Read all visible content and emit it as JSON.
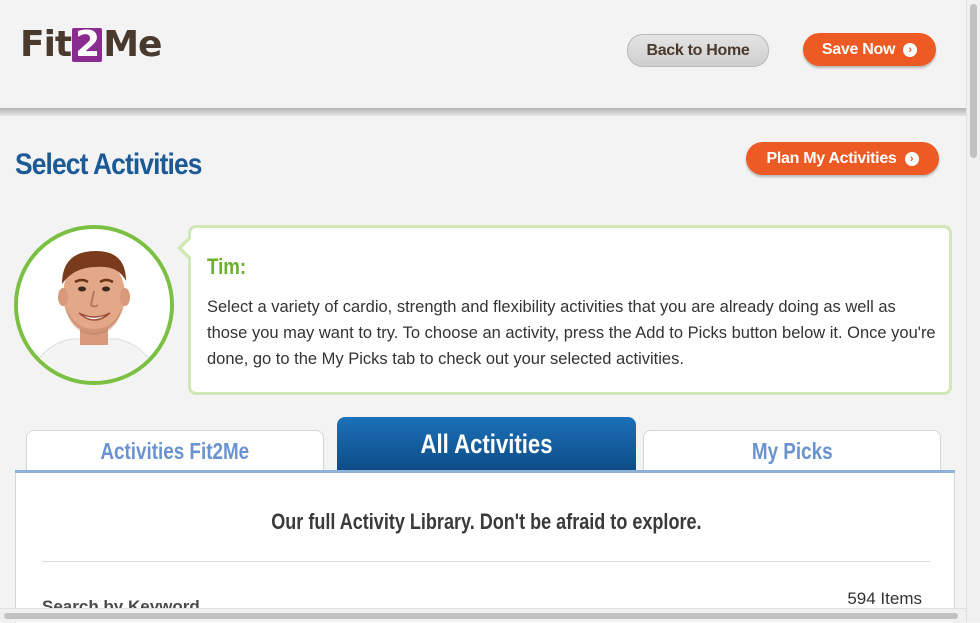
{
  "header": {
    "logo": {
      "part1": "Fit",
      "part2": "2",
      "part3": "Me"
    },
    "back_home_label": "Back to Home",
    "save_now_label": "Save Now"
  },
  "page": {
    "title": "Select Activities",
    "plan_button_label": "Plan My Activities"
  },
  "coach": {
    "name": "Tim:",
    "message": "Select a variety of cardio, strength and flexibility activities that you are already doing as well as those you may want to try. To choose an activity, press the Add to Picks button below it. Once you're done, go to the My Picks tab to check out your selected activities."
  },
  "tabs": [
    {
      "label": "Activities Fit2Me",
      "active": false
    },
    {
      "label": "All Activities",
      "active": true
    },
    {
      "label": "My Picks",
      "active": false
    }
  ],
  "panel": {
    "headline": "Our full Activity Library. Don't be afraid to explore.",
    "search_label": "Search by Keyword",
    "items_count": "594 Items"
  },
  "colors": {
    "accent_orange": "#ee5a24",
    "title_blue": "#1c5a96",
    "coach_green": "#6bb12d",
    "tab_active_blue": "#0d4c86",
    "tab_inactive_text": "#6a93cf"
  },
  "icons": {
    "arrow": "circle-chevron-right-icon"
  }
}
